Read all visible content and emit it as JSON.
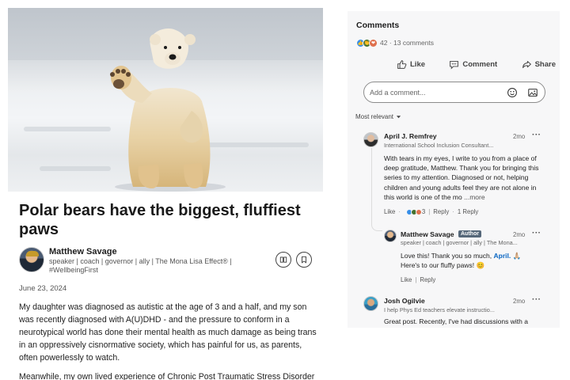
{
  "article": {
    "hero_image_alt": "polar bear standing with paw raised",
    "title": "Polar bears have the biggest, fluffiest paws",
    "author": {
      "name": "Matthew Savage",
      "headline": "speaker | coach | governor | ally | The Mona Lisa Effect® | #WellbeingFirst"
    },
    "date": "June 23, 2024",
    "paragraphs": [
      "My daughter was diagnosed as autistic at the age of 3 and a half, and my son was recently diagnosed with A(U)DHD - and the pressure to conform in a neurotypical world has done their mental health as much damage as being trans in an oppressively cisnormative society, which has painful for us, as parents, often powerlessly to watch.",
      "Meanwhile, my own lived experience of Chronic Post Traumatic Stress Disorder"
    ]
  },
  "comments_panel": {
    "title": "Comments",
    "reaction_summary": "42 · 13 comments",
    "actions": {
      "like": "Like",
      "comment": "Comment",
      "share": "Share"
    },
    "input_placeholder": "Add a comment...",
    "sort_label": "Most relevant",
    "comments": [
      {
        "name": "April J. Remfrey",
        "headline": "International School Inclusion Consultant...",
        "time": "2mo",
        "text": "With tears in my eyes, I write to you from a place of deep gratitude, Matthew. Thank you for bringing this series to my attention. Diagnosed or not, helping children and young adults feel they are not alone in this world is one of the mo",
        "see_more": "...more",
        "like_label": "Like",
        "reaction_count": "3",
        "reply_label": "Reply",
        "reply_count": "1 Reply"
      },
      {
        "name": "Matthew Savage",
        "badge": "Author",
        "headline": "speaker | coach | governor | ally | The Mona...",
        "time": "2mo",
        "text_before": "Love this! Thank you so much, ",
        "mention": "April.",
        "text_after": " 🙏🏼",
        "text_line2": "Here's to our fluffy paws! 😊",
        "like_label": "Like",
        "reply_label": "Reply"
      },
      {
        "name": "Josh Ogilvie",
        "headline": "I help Phys Ed teachers elevate instructio...",
        "time": "2mo",
        "text": "Great post. Recently, I've had discussions with a"
      }
    ]
  },
  "colors": {
    "accent": "#0a66c2",
    "like": "#378fe9",
    "celebrate": "#44712e",
    "love": "#df704d",
    "badge": "#56687a"
  }
}
